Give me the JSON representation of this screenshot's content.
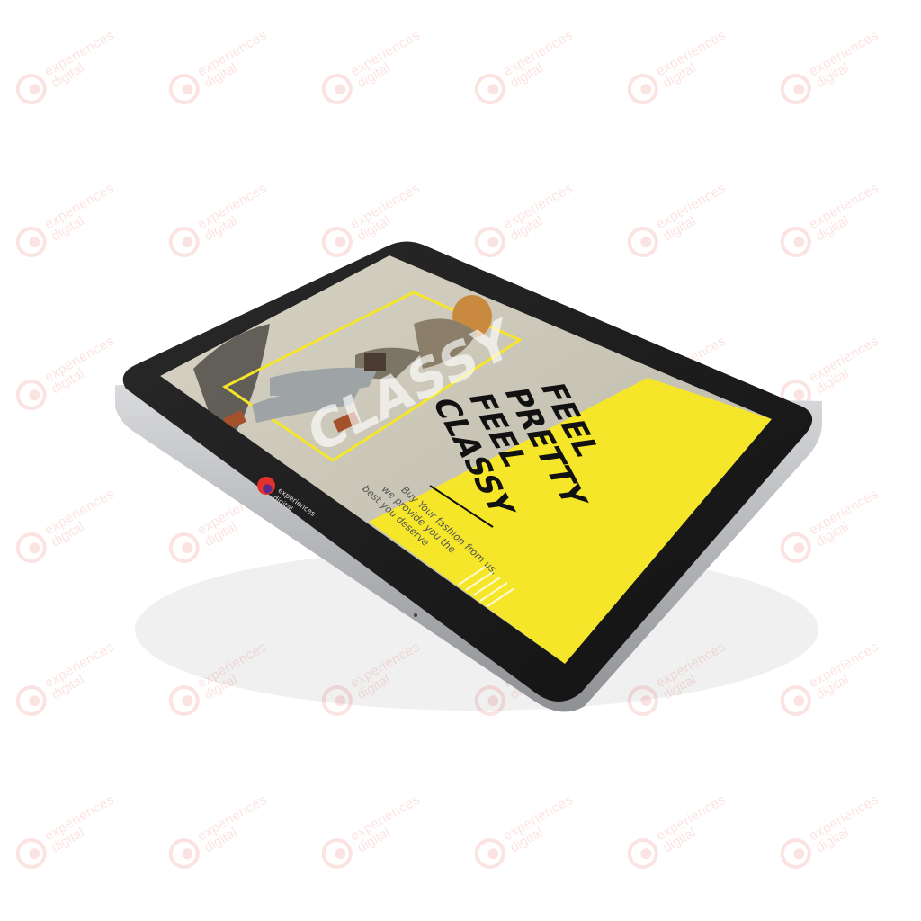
{
  "brand": {
    "line1": "experiences",
    "line2": "digital",
    "colors": {
      "red": "#e3322b",
      "purple": "#5b2a8c"
    }
  },
  "screen": {
    "big_word": "CLASSY",
    "headline": [
      "FEEL",
      "PRETTY",
      "FEEL",
      "CLASSY"
    ],
    "tagline": [
      "Buy Your fashion from us,",
      "we provide you the",
      "best you deserve"
    ],
    "accent_color": "#f5e62a"
  },
  "watermark": {
    "line1": "experiences",
    "line2": "digital",
    "icon": "experiences-digital-logo-icon"
  }
}
